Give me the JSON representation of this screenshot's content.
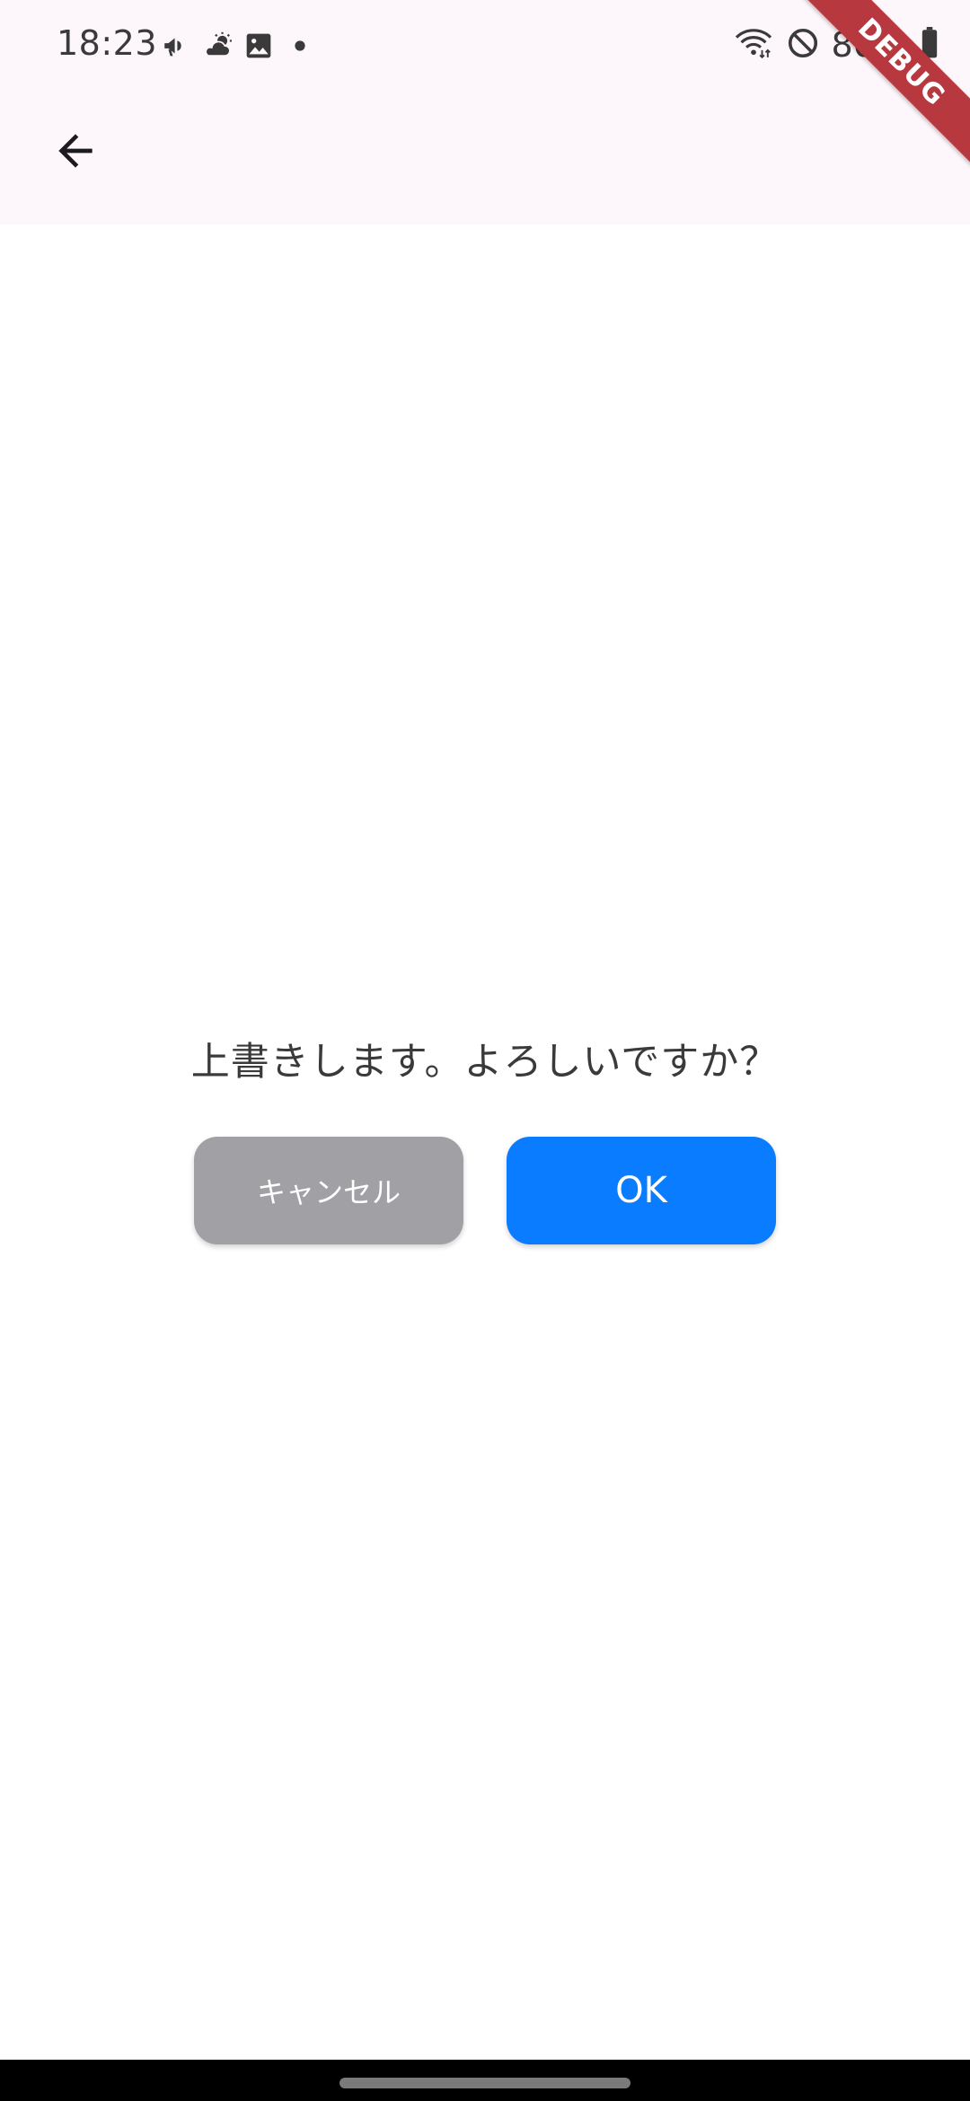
{
  "status_bar": {
    "time": "18:23",
    "battery_percent": "80%",
    "left_icons": [
      "megaphone-icon",
      "partly-cloudy-icon",
      "image-icon",
      "dot-icon"
    ],
    "right_icons": [
      "wifi-icon",
      "do-not-disturb-icon",
      "battery-icon"
    ]
  },
  "app_bar": {
    "back_icon": "arrow-left-icon"
  },
  "debug_banner": {
    "label": "DEBUG",
    "color": "#b8383f"
  },
  "dialog": {
    "message": "上書きします。よろしいですか？",
    "cancel_label": "キャンセル",
    "ok_label": "OK",
    "cancel_color": "#a0a0a5",
    "ok_color": "#0a7cff"
  }
}
